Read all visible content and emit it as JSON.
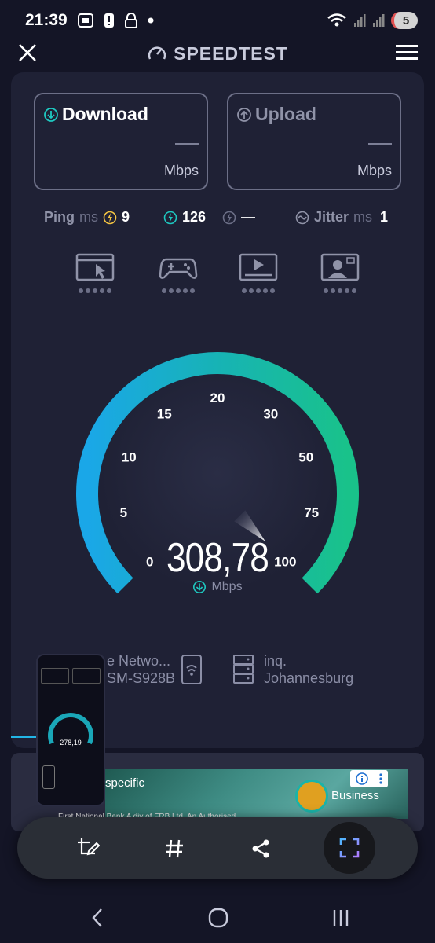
{
  "status": {
    "time": "21:39",
    "battery": "5"
  },
  "app": {
    "title": "SPEEDTEST"
  },
  "download": {
    "label": "Download",
    "value": "—",
    "unit": "Mbps"
  },
  "upload": {
    "label": "Upload",
    "value": "—",
    "unit": "Mbps"
  },
  "metrics": {
    "ping_label": "Ping",
    "ping_unit": "ms",
    "ping_idle": "9",
    "ping_download": "126",
    "ping_upload": "—",
    "jitter_label": "Jitter",
    "jitter_unit": "ms",
    "jitter_value": "1"
  },
  "quality_icons": [
    "browsing-icon",
    "gaming-icon",
    "video-streaming-icon",
    "video-call-icon"
  ],
  "gauge": {
    "ticks": [
      "0",
      "5",
      "10",
      "15",
      "20",
      "30",
      "50",
      "75",
      "100"
    ],
    "reading": "308,78",
    "unit": "Mbps",
    "needle_fraction": 1.0
  },
  "server": {
    "network_line1": "e Netwo...",
    "network_line2": "SM-S928B",
    "host_line1": "inq.",
    "host_line2": "Johannesburg"
  },
  "ad": {
    "headline": "specific",
    "brand_text": "Business",
    "footer": "First National Bank  A div of FRB Ltd. An Authorised"
  },
  "pip": {
    "reading": "278,19"
  },
  "colors": {
    "accent_start": "#1aa7e8",
    "accent_end": "#19c28a",
    "bg": "#141526",
    "card": "#1f2135"
  }
}
